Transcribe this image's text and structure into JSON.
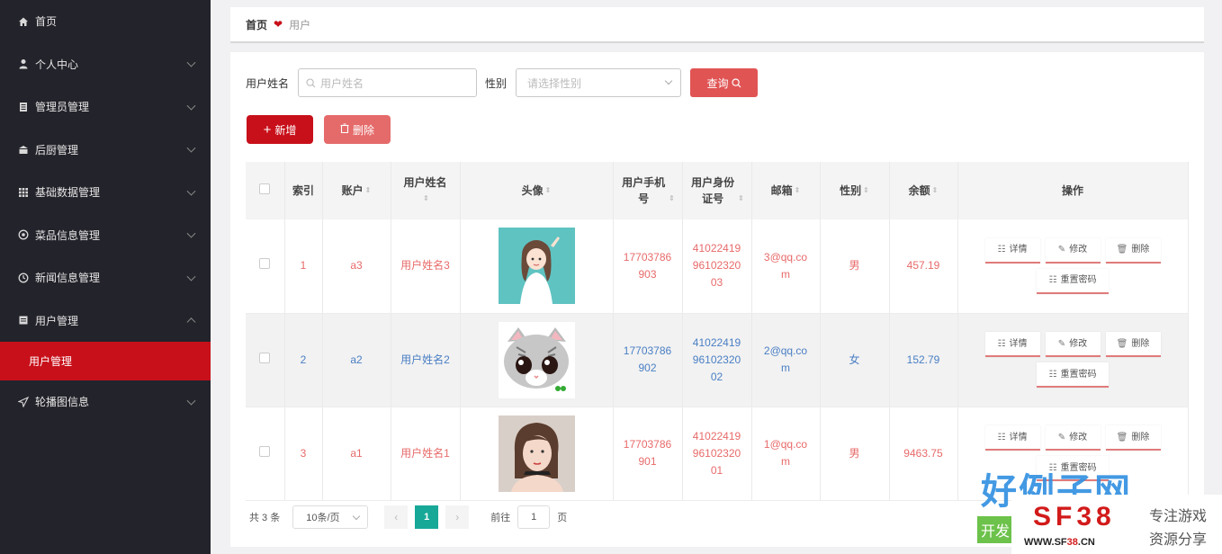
{
  "sidebar": {
    "items": [
      {
        "label": "首页",
        "icon": "home-icon",
        "chevron": ""
      },
      {
        "label": "个人中心",
        "icon": "user-icon",
        "chevron": "down"
      },
      {
        "label": "管理员管理",
        "icon": "document-icon",
        "chevron": "down"
      },
      {
        "label": "后厨管理",
        "icon": "kitchen-icon",
        "chevron": "down"
      },
      {
        "label": "基础数据管理",
        "icon": "grid-icon",
        "chevron": "down"
      },
      {
        "label": "菜品信息管理",
        "icon": "dish-icon",
        "chevron": "down"
      },
      {
        "label": "新闻信息管理",
        "icon": "clock-icon",
        "chevron": "down"
      },
      {
        "label": "用户管理",
        "icon": "users-icon",
        "chevron": "up"
      }
    ],
    "active_sub": "用户管理",
    "last_item": {
      "label": "轮播图信息",
      "icon": "send-icon"
    },
    "active_color": "#c8101a"
  },
  "breadcrumb": {
    "home": "首页",
    "separator_icon": "heart-icon",
    "current": "用户"
  },
  "search": {
    "name_label": "用户姓名",
    "name_placeholder": "用户姓名",
    "gender_label": "性别",
    "gender_placeholder": "请选择性别",
    "query_button": "查询"
  },
  "actions": {
    "add": "新增",
    "delete": "删除"
  },
  "table": {
    "headers": {
      "index": "索引",
      "account": "账户",
      "name": "用户姓名",
      "avatar": "头像",
      "phone": "用户手机号",
      "idcard": "用户身份证号",
      "email": "邮箱",
      "gender": "性别",
      "balance": "余额",
      "ops": "操作"
    },
    "rows": [
      {
        "index": "1",
        "account": "a3",
        "name": "用户姓名3",
        "avatar": "avatar-girl-icon",
        "phone": "17703786903",
        "idcard": "410224199610232003",
        "email": "3@qq.com",
        "gender": "男",
        "balance": "457.19"
      },
      {
        "index": "2",
        "account": "a2",
        "name": "用户姓名2",
        "avatar": "avatar-cat-icon",
        "phone": "17703786902",
        "idcard": "410224199610232002",
        "email": "2@qq.com",
        "gender": "女",
        "balance": "152.79"
      },
      {
        "index": "3",
        "account": "a1",
        "name": "用户姓名1",
        "avatar": "avatar-woman-icon",
        "phone": "17703786901",
        "idcard": "410224199610232001",
        "email": "1@qq.com",
        "gender": "男",
        "balance": "9463.75"
      }
    ],
    "row_ops": {
      "detail": "详情",
      "edit": "修改",
      "delete": "删除",
      "reset": "重置密码"
    }
  },
  "pagination": {
    "total": "共 3 条",
    "page_size": "10条/页",
    "current_page": "1",
    "goto_label": "前往",
    "goto_value": "1",
    "page_unit": "页"
  },
  "watermark": {
    "title": "好例子网",
    "tag": "开发",
    "brand": "SF38",
    "url_prefix": "WWW.SF",
    "url_num": "38",
    "url_suffix": ".CN",
    "slogan1": "专注游戏",
    "slogan2": "资源分享"
  }
}
